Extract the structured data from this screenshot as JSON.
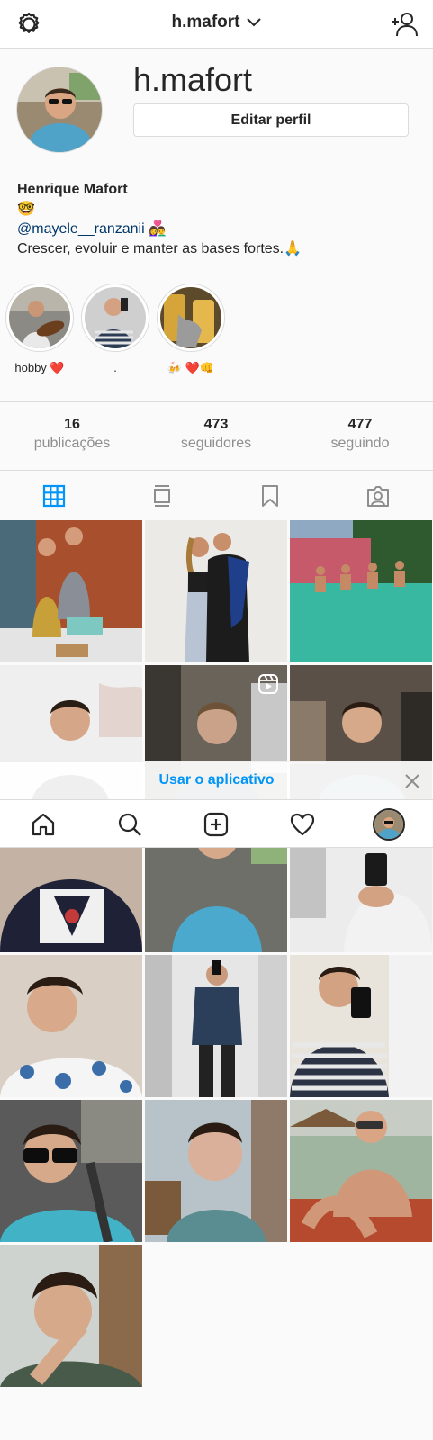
{
  "topbar": {
    "username": "h.mafort"
  },
  "profile": {
    "username": "h.mafort",
    "edit_label": "Editar perfil",
    "full_name": "Henrique Mafort",
    "emoji_line": "🤓",
    "mention": "@mayele__ranzanii",
    "mention_emoji": "👩‍❤️‍👨",
    "bio_line": "Crescer, evoluir e manter as bases fortes.🙏"
  },
  "highlights": [
    {
      "label": "hobby ❤️"
    },
    {
      "label": "."
    },
    {
      "label": "🍻 ❤️👊"
    }
  ],
  "stats": [
    {
      "number": "16",
      "label": "publicações"
    },
    {
      "number": "473",
      "label": "seguidores"
    },
    {
      "number": "477",
      "label": "seguindo"
    }
  ],
  "banner": {
    "text": "Usar o aplicativo"
  },
  "colors": {
    "accent": "#0095f6",
    "mention": "#00376b",
    "muted": "#8e8e8e",
    "border": "#dbdbdb"
  },
  "icons": [
    "gear-icon",
    "chevron-down-icon",
    "add-user-icon",
    "grid-icon",
    "igtv-icon",
    "bookmark-icon",
    "tagged-icon",
    "reel-icon",
    "close-icon",
    "home-icon",
    "search-icon",
    "new-post-icon",
    "heart-icon"
  ]
}
